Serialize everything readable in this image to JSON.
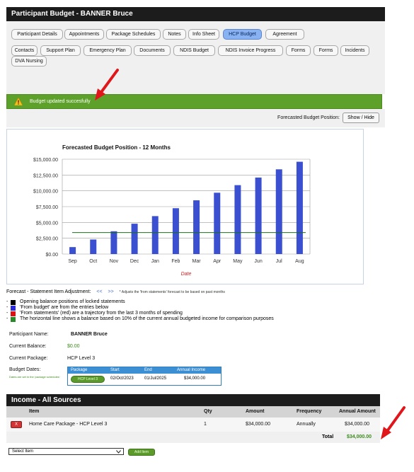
{
  "page": {
    "title": "Participant Budget - BANNER Bruce"
  },
  "tabs": [
    {
      "label": "Participant Details",
      "active": false
    },
    {
      "label": "Appointments",
      "active": false
    },
    {
      "label": "Package Schedules",
      "active": false
    },
    {
      "label": "Notes",
      "active": false
    },
    {
      "label": "Info Sheet",
      "active": false
    },
    {
      "label": "HCP Budget",
      "active": true
    },
    {
      "label": "Agreement",
      "active": false
    },
    {
      "label": "Contacts",
      "active": false
    },
    {
      "label": "Support Plan",
      "active": false
    },
    {
      "label": "Emergency Plan",
      "active": false
    },
    {
      "label": "Documents",
      "active": false
    },
    {
      "label": "NDIS Budget",
      "active": false
    },
    {
      "label": "NDIS Invoice Progress",
      "active": false
    },
    {
      "label": "Forms",
      "active": false
    },
    {
      "label": "Forms",
      "active": false
    },
    {
      "label": "Incidents",
      "active": false
    },
    {
      "label": "DVA Nursing",
      "active": false
    }
  ],
  "alert": {
    "message": "Budget updated succesfully",
    "icon": "warning-icon",
    "color": "#5da12a"
  },
  "forecast": {
    "label": "Forecasted Budget Position:",
    "button": "Show / Hide"
  },
  "chart_data": {
    "type": "bar",
    "title": "Forecasted Budget Position - 12 Months",
    "xlabel": "Date",
    "ylabel": "",
    "categories": [
      "Sep",
      "Oct",
      "Nov",
      "Dec",
      "Jan",
      "Feb",
      "Mar",
      "Apr",
      "May",
      "Jun",
      "Jul",
      "Aug"
    ],
    "values": [
      1100,
      2300,
      3600,
      4800,
      6000,
      7250,
      8500,
      9700,
      10900,
      12100,
      13400,
      14600
    ],
    "ylim": [
      0,
      15000
    ],
    "yticks": [
      "$0.00",
      "$2,500.00",
      "$5,000.00",
      "$7,500.00",
      "$10,000.00",
      "$12,500.00",
      "$15,000.00"
    ],
    "reference_line": 3400,
    "bar_color": "#3a50d0",
    "line_color": "#1e6b1e",
    "grid": true
  },
  "adjustment": {
    "label": "Forecast - Statement Item Adjustment:",
    "prev": "<<",
    "next": ">>",
    "note": "* Adjusts the 'from statements' forecast to be based on past months"
  },
  "legend": [
    {
      "color": "#000000",
      "text": "Opening balance positions of locked statements"
    },
    {
      "color": "#2a2ad8",
      "text": "'From budget' are from the entries below"
    },
    {
      "color": "#dd1111",
      "text": "'From statements' (red) are a trajectory from the last 3 months of spending"
    },
    {
      "color": "#2a8a2a",
      "text": "The horizontal line shows a balance based on 10% of the current annual budgeted income for comparison purposes"
    }
  ],
  "participant": {
    "name_label": "Participant Name:",
    "name": "BANNER Bruce",
    "balance_label": "Current Balance:",
    "balance": "$0.00",
    "package_label": "Current Package:",
    "package": "HCP Level 3",
    "dates_label": "Budget Dates:",
    "dates_note": "Dates are set in the 'package schedules'"
  },
  "dates_table": {
    "headers": [
      "Package",
      "Start",
      "End",
      "Annual Income"
    ],
    "row": {
      "package": "HCP Level 3",
      "start": "02/Oct/2023",
      "end": "01/Jul/2025",
      "income": "$34,000.00"
    }
  },
  "income": {
    "title": "Income - All Sources",
    "headers": {
      "item": "Item",
      "qty": "Qty",
      "amount": "Amount",
      "frequency": "Frequency",
      "annual": "Annual Amount"
    },
    "rows": [
      {
        "remove": "X",
        "item": "Home Care Package - HCP Level 3",
        "qty": "1",
        "amount": "$34,000.00",
        "frequency": "Annually",
        "annual": "$34,000.00"
      }
    ],
    "total_label": "Total",
    "total": "$34,000.00"
  },
  "add": {
    "select_placeholder": "Select Item",
    "button": "Add Item"
  }
}
